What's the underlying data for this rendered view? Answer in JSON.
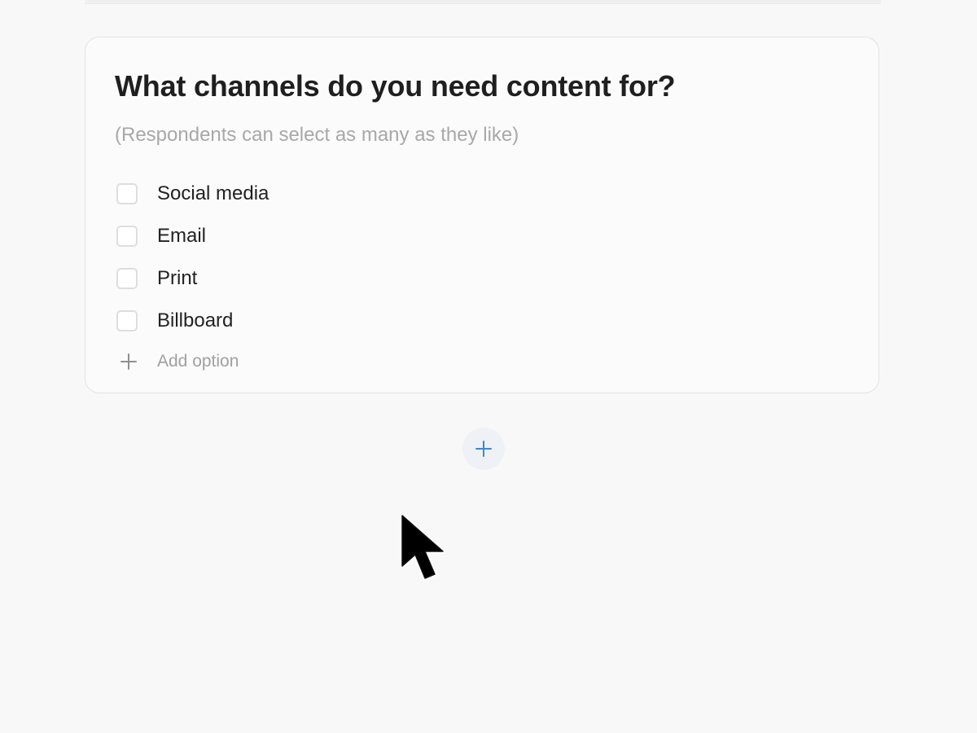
{
  "question_card": {
    "title": "What channels do you need content for?",
    "hint": "(Respondents can select as many as they like)",
    "options": [
      {
        "label": "Social media",
        "checked": false
      },
      {
        "label": "Email",
        "checked": false
      },
      {
        "label": "Print",
        "checked": false
      },
      {
        "label": "Billboard",
        "checked": false
      }
    ],
    "add_option_label": "Add option"
  },
  "add_question_button": {
    "icon": "plus-icon"
  },
  "cursor": {
    "icon": "mouse-pointer-icon"
  },
  "colors": {
    "background": "#f8f8f8",
    "card_background": "#fbfbfb",
    "border": "#e3e3e3",
    "title": "#1f1f1f",
    "hint": "#a8a8a8",
    "accent": "#3f86d2",
    "button_background": "#eef2f7"
  }
}
